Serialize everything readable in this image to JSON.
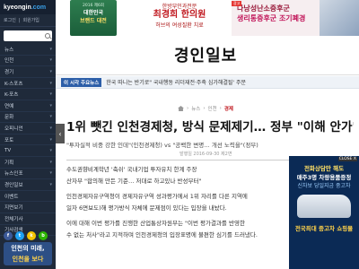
{
  "sidebar": {
    "logo_main": "kyeongin",
    "logo_dot": ".com",
    "login": "로그인",
    "join": "회원가입",
    "items": [
      {
        "label": "뉴스"
      },
      {
        "label": "인천"
      },
      {
        "label": "경기"
      },
      {
        "label": "K-스포츠"
      },
      {
        "label": "K-포츠"
      },
      {
        "label": "연예"
      },
      {
        "label": "문화"
      },
      {
        "label": "오피니언"
      },
      {
        "label": "포토"
      },
      {
        "label": "TV"
      },
      {
        "label": "기획"
      },
      {
        "label": "뉴스인포"
      },
      {
        "label": "경인일보"
      },
      {
        "label": "이벤트"
      },
      {
        "label": "지면보기"
      },
      {
        "label": "전체기사"
      },
      {
        "label": "기사검색"
      }
    ],
    "banner_line1": "인천의 미래,",
    "banner_line2": "인천을 보다"
  },
  "ads": {
    "top_left": {
      "line1": "2016 제6회",
      "line2": "대한민국",
      "line3": "브랜드 대전"
    },
    "top_mid": {
      "line1": "한방부인과전문",
      "line2": "최경희 한의원",
      "line3": "허브의 여성질환 치료"
    },
    "top_right": {
      "badge": "광고",
      "line1": "다낭성난소증후군",
      "line2": "생리통증후군 조기폐경"
    },
    "float": {
      "close": "CLOSE X",
      "line1": "전화상담만 해도",
      "line2": "매주3명 차량용품증정",
      "line3": "신차보 당일지금 중고차",
      "line4": "전국최대 중고차 쇼핑몰"
    }
  },
  "header": {
    "masthead": "경인일보"
  },
  "ticker": {
    "label": "이 시각 주요뉴스",
    "text": "한국 따니는 반기로\" 국내행동 리더재전·주축 심가해결될' 주문"
  },
  "breadcrumb": {
    "items": [
      "뉴스",
      "인천",
      "경제"
    ]
  },
  "article": {
    "title": "1위 뺏긴 인천경제청, 방식 문제제기… 정부 \"이해 안가\"",
    "subtitle": "\"투자실적 비중 강한 인데\"(인천경제청) vs \"공백한 변명… 개선 노력을\"(정부)",
    "subtitle2": "",
    "meta": "발행일 2016-09-30 제2면",
    "paragraphs": [
      "수도권향비계학년 '축쉬' 국내기업 투자유치 한계 주장",
      "산자부 \"합의해 만든 기준… 저대로 하고있나 반성부터\"",
      "인천경제자유구역청이 경제자유구역 성과평가에서 1위 자리를 다른 지역에",
      "일자 6면보도)해 평가방식 자체에 문제점이 있다는 입장을 내놨다.",
      "이에 대해 이번 평가를 진행한 산업통상자원부는 \"이번 평가결과를 반영한",
      "수 없는 처사\"라고 지적하며 인천경제청의 입장표명에 불편한 심기를 드러냈다."
    ]
  }
}
